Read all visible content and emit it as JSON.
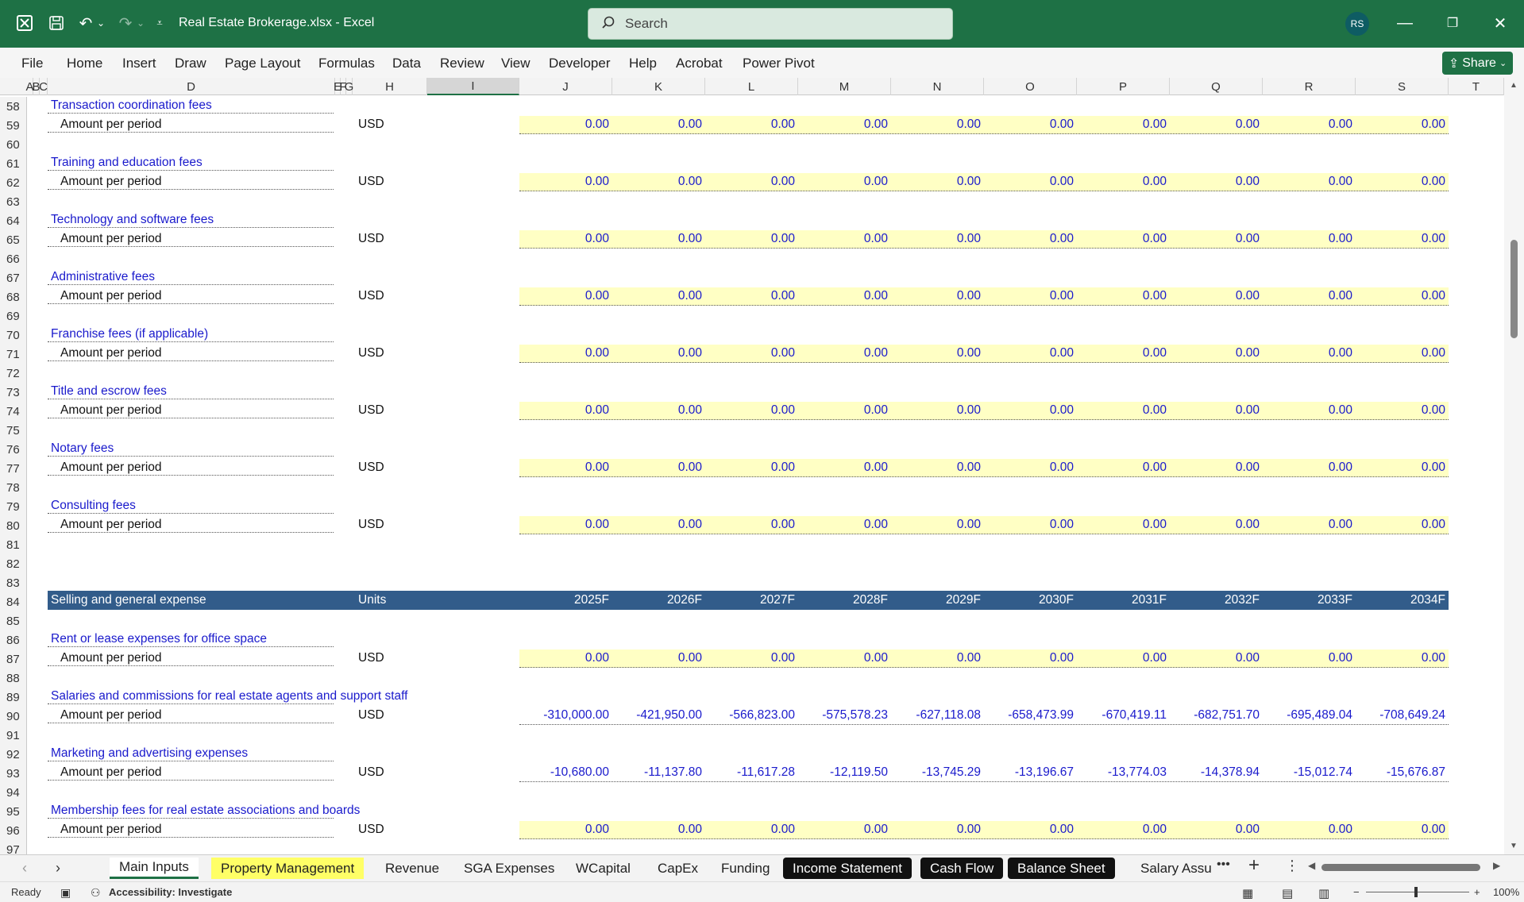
{
  "app": {
    "title": "Real Estate Brokerage.xlsx  -  Excel",
    "search_placeholder": "Search",
    "user_initials": "RS"
  },
  "menu": [
    "File",
    "Home",
    "Insert",
    "Draw",
    "Page Layout",
    "Formulas",
    "Data",
    "Review",
    "View",
    "Developer",
    "Help",
    "Acrobat",
    "Power Pivot"
  ],
  "share_label": "Share",
  "columns": [
    "A",
    "B",
    "C",
    "D",
    "E",
    "F",
    "G",
    "H",
    "I",
    "J",
    "K",
    "L",
    "M",
    "N",
    "O",
    "P",
    "Q",
    "R",
    "S",
    "T"
  ],
  "rows": [
    "58",
    "59",
    "60",
    "61",
    "62",
    "63",
    "64",
    "65",
    "66",
    "67",
    "68",
    "69",
    "70",
    "71",
    "72",
    "73",
    "74",
    "75",
    "76",
    "77",
    "78",
    "79",
    "80",
    "81",
    "82",
    "83",
    "84",
    "85",
    "86",
    "87",
    "88",
    "89",
    "90",
    "91",
    "92",
    "93",
    "94",
    "95",
    "96",
    "97"
  ],
  "revenue_items": [
    {
      "label": "Transaction coordination fees",
      "sub": "Amount per period",
      "unit": "USD",
      "values": [
        "0.00",
        "0.00",
        "0.00",
        "0.00",
        "0.00",
        "0.00",
        "0.00",
        "0.00",
        "0.00",
        "0.00"
      ]
    },
    {
      "label": "Training and education fees",
      "sub": "Amount per period",
      "unit": "USD",
      "values": [
        "0.00",
        "0.00",
        "0.00",
        "0.00",
        "0.00",
        "0.00",
        "0.00",
        "0.00",
        "0.00",
        "0.00"
      ]
    },
    {
      "label": "Technology and software fees",
      "sub": "Amount per period",
      "unit": "USD",
      "values": [
        "0.00",
        "0.00",
        "0.00",
        "0.00",
        "0.00",
        "0.00",
        "0.00",
        "0.00",
        "0.00",
        "0.00"
      ]
    },
    {
      "label": "Administrative fees",
      "sub": "Amount per period",
      "unit": "USD",
      "values": [
        "0.00",
        "0.00",
        "0.00",
        "0.00",
        "0.00",
        "0.00",
        "0.00",
        "0.00",
        "0.00",
        "0.00"
      ]
    },
    {
      "label": "Franchise fees (if applicable)",
      "sub": "Amount per period",
      "unit": "USD",
      "values": [
        "0.00",
        "0.00",
        "0.00",
        "0.00",
        "0.00",
        "0.00",
        "0.00",
        "0.00",
        "0.00",
        "0.00"
      ]
    },
    {
      "label": "Title and escrow fees",
      "sub": "Amount per period",
      "unit": "USD",
      "values": [
        "0.00",
        "0.00",
        "0.00",
        "0.00",
        "0.00",
        "0.00",
        "0.00",
        "0.00",
        "0.00",
        "0.00"
      ]
    },
    {
      "label": "Notary fees",
      "sub": "Amount per period",
      "unit": "USD",
      "values": [
        "0.00",
        "0.00",
        "0.00",
        "0.00",
        "0.00",
        "0.00",
        "0.00",
        "0.00",
        "0.00",
        "0.00"
      ]
    },
    {
      "label": "Consulting fees",
      "sub": "Amount per period",
      "unit": "USD",
      "values": [
        "0.00",
        "0.00",
        "0.00",
        "0.00",
        "0.00",
        "0.00",
        "0.00",
        "0.00",
        "0.00",
        "0.00"
      ]
    }
  ],
  "sga_header": {
    "label": "Selling and general expense",
    "units": "Units",
    "years": [
      "2025F",
      "2026F",
      "2027F",
      "2028F",
      "2029F",
      "2030F",
      "2031F",
      "2032F",
      "2033F",
      "2034F"
    ]
  },
  "sga_items": [
    {
      "label": "Rent or lease expenses for office space",
      "sub": "Amount per period",
      "unit": "USD",
      "highlight": true,
      "values": [
        "0.00",
        "0.00",
        "0.00",
        "0.00",
        "0.00",
        "0.00",
        "0.00",
        "0.00",
        "0.00",
        "0.00"
      ]
    },
    {
      "label": "Salaries and commissions for real estate agents and support staff",
      "sub": "Amount per period",
      "unit": "USD",
      "highlight": false,
      "values": [
        "-310,000.00",
        "-421,950.00",
        "-566,823.00",
        "-575,578.23",
        "-627,118.08",
        "-658,473.99",
        "-670,419.11",
        "-682,751.70",
        "-695,489.04",
        "-708,649.24"
      ]
    },
    {
      "label": "Marketing and advertising expenses",
      "sub": "Amount per period",
      "unit": "USD",
      "highlight": false,
      "values": [
        "-10,680.00",
        "-11,137.80",
        "-11,617.28",
        "-12,119.50",
        "-13,745.29",
        "-13,196.67",
        "-13,774.03",
        "-14,378.94",
        "-15,012.74",
        "-15,676.87"
      ]
    },
    {
      "label": "Membership fees for real estate associations and boards",
      "sub": "Amount per period",
      "unit": "USD",
      "highlight": true,
      "values": [
        "0.00",
        "0.00",
        "0.00",
        "0.00",
        "0.00",
        "0.00",
        "0.00",
        "0.00",
        "0.00",
        "0.00"
      ]
    }
  ],
  "sheet_tabs": [
    {
      "label": "Main Inputs",
      "style": "active"
    },
    {
      "label": "Property Management",
      "style": "yellow"
    },
    {
      "label": "Revenue",
      "style": "plain"
    },
    {
      "label": "SGA Expenses",
      "style": "plain"
    },
    {
      "label": "WCapital",
      "style": "plain"
    },
    {
      "label": "CapEx",
      "style": "plain"
    },
    {
      "label": "Funding",
      "style": "plain"
    },
    {
      "label": "Income Statement",
      "style": "black"
    },
    {
      "label": "Cash Flow",
      "style": "black"
    },
    {
      "label": "Balance Sheet",
      "style": "black"
    },
    {
      "label": "Salary Assu",
      "style": "plain"
    }
  ],
  "status": {
    "ready": "Ready",
    "accessibility": "Accessibility: Investigate",
    "zoom": "100%"
  },
  "colors": {
    "title_bar": "#1e7145",
    "header_band": "#325c8a",
    "input_fill": "#ffffc4",
    "link_blue": "#1a1acc"
  }
}
